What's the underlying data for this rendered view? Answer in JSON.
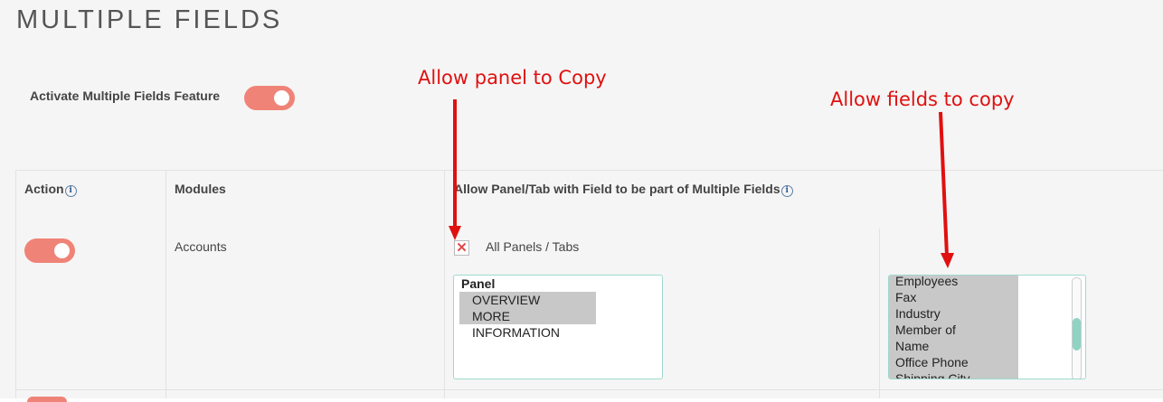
{
  "page": {
    "title": "MULTIPLE FIELDS"
  },
  "feature": {
    "label": "Activate Multiple Fields Feature",
    "enabled": true
  },
  "annotations": {
    "panel_note": "Allow panel to Copy",
    "fields_note": "Allow fields to copy",
    "color": "#e01010"
  },
  "table": {
    "headers": {
      "action": "Action",
      "modules": "Modules",
      "allow": "Allow Panel/Tab with Field to be part of Multiple Fields"
    },
    "info_icon": "i",
    "rows": [
      {
        "enabled": true,
        "module": "Accounts",
        "all_panels_checked": false,
        "all_panels_label": "All Panels / Tabs",
        "panel_group_label": "Panel",
        "panels": [
          "OVERVIEW",
          "MORE INFORMATION"
        ],
        "fields": [
          "Employees",
          "Fax",
          "Industry",
          "Member of",
          "Name",
          "Office Phone",
          "Shipping City"
        ]
      }
    ]
  },
  "colors": {
    "toggle_on": "#f08377",
    "listbox_border": "#9fd9cf",
    "selected_option": "#c8c8c8"
  },
  "icons": {
    "checkbox_mark": "close-x-icon",
    "info": "info-icon"
  }
}
